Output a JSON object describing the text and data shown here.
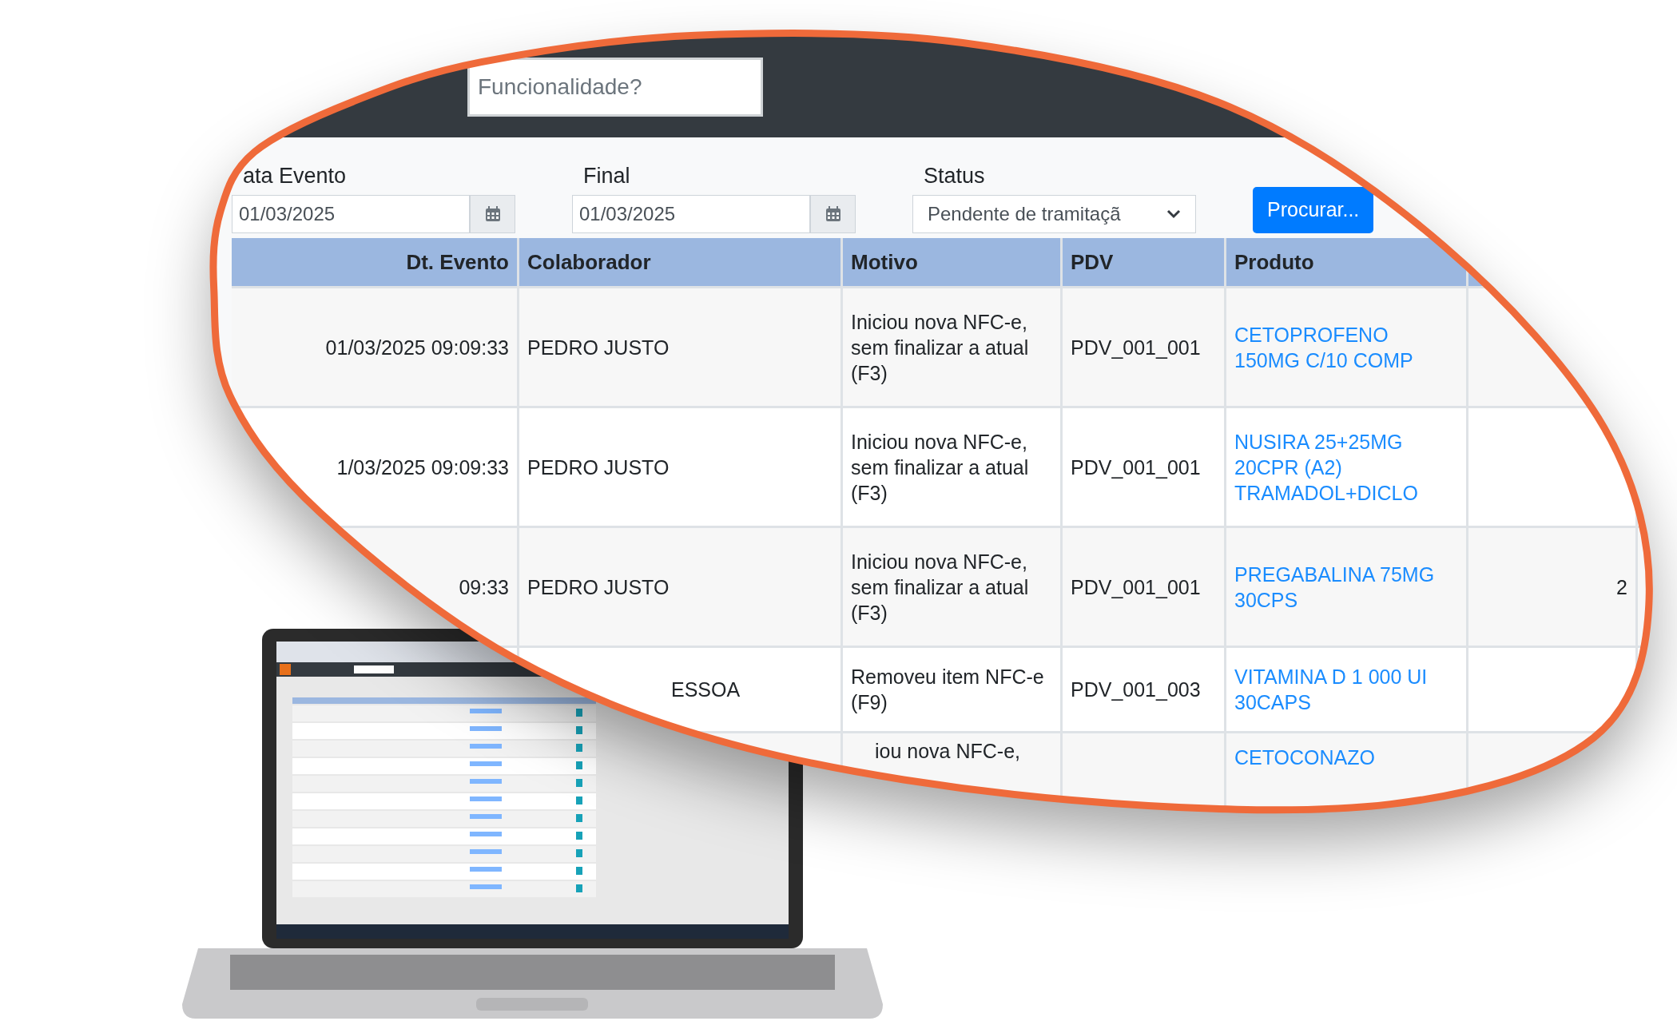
{
  "search": {
    "placeholder": "Funcionalidade?"
  },
  "filters": [
    {
      "kind": "date",
      "label": "ata Evento",
      "value": "01/03/2025"
    },
    {
      "kind": "date",
      "label": "Final",
      "value": "01/03/2025"
    },
    {
      "kind": "select",
      "label": "Status",
      "value": "Pendente de tramitaçã"
    }
  ],
  "search_button": "Procurar...",
  "table": {
    "columns": [
      "Dt. Evento",
      "Colaborador",
      "Motivo",
      "PDV",
      "Produto"
    ],
    "rows": [
      {
        "dt_evento": "01/03/2025 09:09:33",
        "colaborador": "PEDRO JUSTO",
        "motivo": "Iniciou nova NFC-e, sem finalizar a atual (F3)",
        "pdv": "PDV_001_001",
        "produto": "CETOPROFENO 150MG C/10 COMP"
      },
      {
        "dt_evento": "1/03/2025 09:09:33",
        "colaborador": "PEDRO JUSTO",
        "motivo": "Iniciou nova NFC-e, sem finalizar a atual (F3)",
        "pdv": "PDV_001_001",
        "produto": "NUSIRA 25+25MG 20CPR (A2) TRAMADOL+DICLO"
      },
      {
        "dt_evento": "09:33",
        "colaborador": "PEDRO JUSTO",
        "motivo": "Iniciou nova NFC-e, sem finalizar a atual (F3)",
        "pdv": "PDV_001_001",
        "produto": "PREGABALINA 75MG 30CPS",
        "column_6": "2"
      },
      {
        "colaborador": "ESSOA",
        "motivo": "Removeu item NFC-e (F9)",
        "pdv": "PDV_001_003",
        "produto": "VITAMINA D 1 000 UI 30CAPS"
      },
      {
        "motivo": "iou nova NFC-e,",
        "produto": "CETOCONAZO"
      }
    ]
  }
}
